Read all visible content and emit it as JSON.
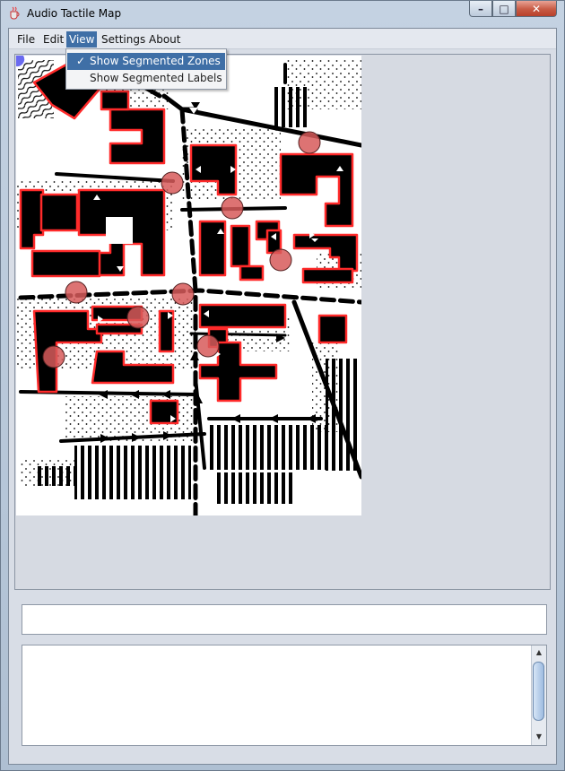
{
  "window": {
    "title": "Audio Tactile Map",
    "app_icon": "java-cup-icon",
    "controls": {
      "minimize": "–",
      "maximize": "□",
      "close": "✕"
    }
  },
  "menubar": {
    "items": [
      {
        "label": "File"
      },
      {
        "label": "Edit"
      },
      {
        "label": "View"
      },
      {
        "label": "Settings"
      },
      {
        "label": "About"
      }
    ],
    "active_index": 2
  },
  "view_menu": {
    "items": [
      {
        "label": "Show Segmented Zones",
        "checked": true,
        "check_glyph": "✓"
      },
      {
        "label": "Show Segmented Labels",
        "checked": false
      }
    ]
  },
  "status_field": {
    "value": ""
  },
  "output_area": {
    "value": ""
  },
  "scrollbar": {
    "up": "▲",
    "down": "▼"
  },
  "colors": {
    "zone_outline": "#ff2a2a",
    "marker_fill": "#d75a5a",
    "menu_highlight": "#3f6fa6"
  }
}
